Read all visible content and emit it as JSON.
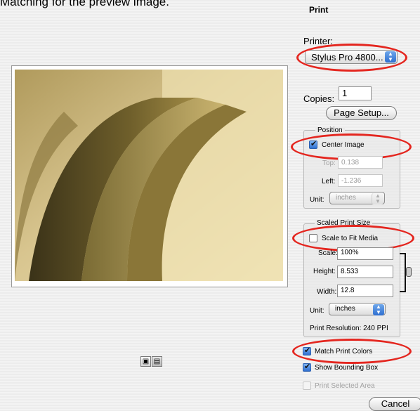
{
  "caption": "Matching for the preview image.",
  "window": {
    "title": "Print"
  },
  "printer": {
    "label": "Printer:",
    "value": "Stylus Pro 4800..."
  },
  "copies": {
    "label": "Copies:",
    "value": "1"
  },
  "page_setup_button": "Page Setup...",
  "position": {
    "title": "Position",
    "center_image_label": "Center Image",
    "center_image_checked": true,
    "top_label": "Top:",
    "top_value": "0.138",
    "left_label": "Left:",
    "left_value": "-1.236",
    "unit_label": "Unit:",
    "unit_value": "inches"
  },
  "scaled_print_size": {
    "title": "Scaled Print Size",
    "scale_to_fit_label": "Scale to Fit Media",
    "scale_to_fit_checked": false,
    "scale_label": "Scale:",
    "scale_value": "100%",
    "height_label": "Height:",
    "height_value": "8.533",
    "width_label": "Width:",
    "width_value": "12.8",
    "unit_label": "Unit:",
    "unit_value": "inches",
    "print_resolution": "Print Resolution: 240 PPI"
  },
  "options": {
    "match_print_colors": "Match Print Colors",
    "show_bounding_box": "Show Bounding Box",
    "print_selected_area": "Print Selected Area"
  },
  "cancel_button": "Cancel",
  "icons": {
    "popup_arrows": "⌃⌄",
    "chain_link": "chain-link-icon",
    "preview_toggle_1": "page-icon",
    "preview_toggle_2": "page-color-icon"
  }
}
